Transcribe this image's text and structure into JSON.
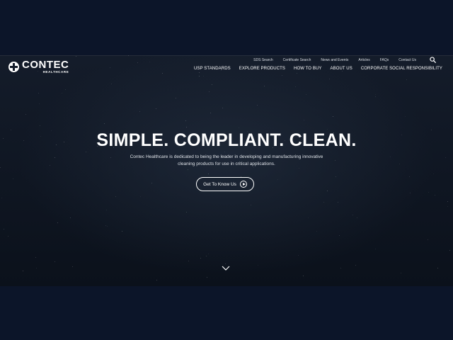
{
  "brand": {
    "name": "CONTEC",
    "sub": "HEALTHCARE"
  },
  "utility_nav": [
    {
      "label": "SDS Search"
    },
    {
      "label": "Certificate Search"
    },
    {
      "label": "News and Events"
    },
    {
      "label": "Articles"
    },
    {
      "label": "FAQs"
    },
    {
      "label": "Contact Us"
    }
  ],
  "main_nav": [
    {
      "label": "USP STANDARDS"
    },
    {
      "label": "EXPLORE PRODUCTS"
    },
    {
      "label": "HOW TO BUY"
    },
    {
      "label": "ABOUT US"
    },
    {
      "label": "CORPORATE SOCIAL RESPONSIBILITY"
    }
  ],
  "hero": {
    "headline": "SIMPLE. COMPLIANT. CLEAN.",
    "subtext": "Contec Healthcare is dedicated to being the leader in developing and manufacturing innovative cleaning products for use in critical applications.",
    "cta_label": "Get To Know Us"
  },
  "icons": {
    "search": "search-icon",
    "play": "play-icon",
    "scroll": "chevron-down-icon",
    "logo": "contec-cross-icon"
  },
  "colors": {
    "page_background": "#0c1529",
    "hero_background": "#121a27",
    "text": "#ffffff"
  }
}
